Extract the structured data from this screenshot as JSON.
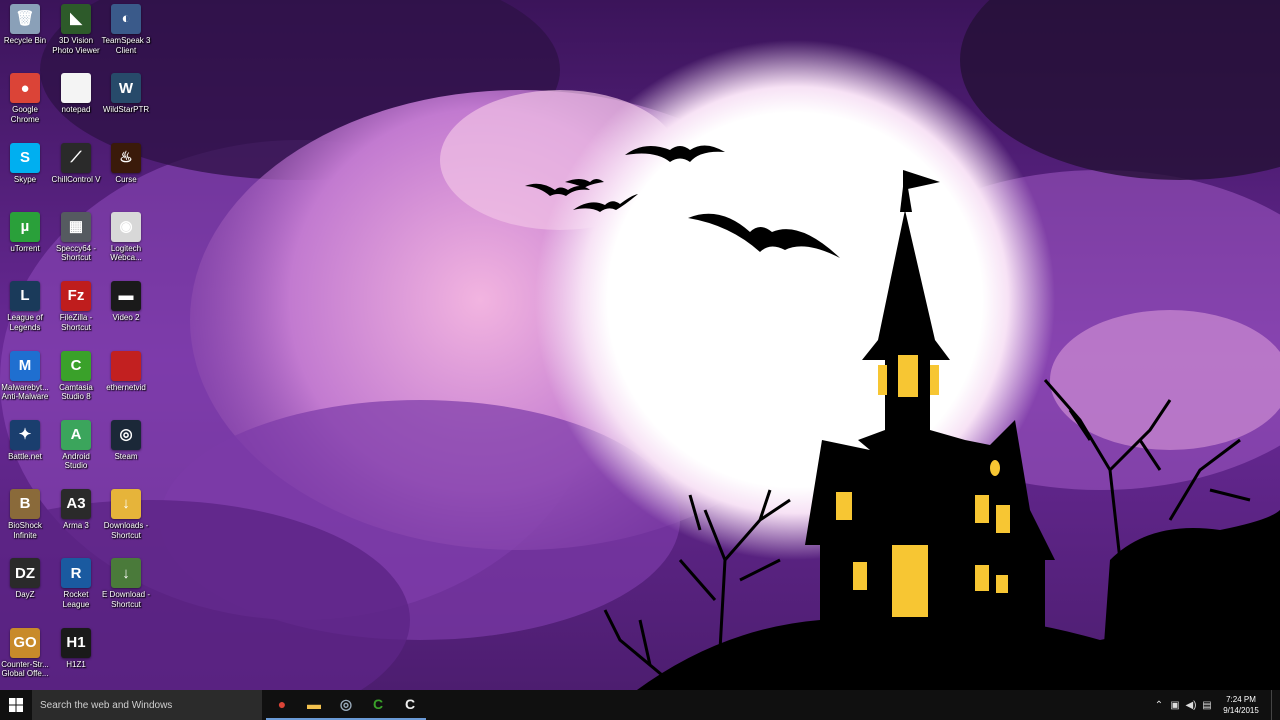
{
  "desktop": {
    "icons": [
      {
        "label": "Recycle Bin",
        "glyph": "🗑",
        "bg": "#8aa0b8"
      },
      {
        "label": "3D Vision Photo Viewer",
        "glyph": "◣",
        "bg": "#2d5a2a"
      },
      {
        "label": "TeamSpeak 3 Client",
        "glyph": "◐",
        "bg": "#3a5a8a"
      },
      {
        "label": "Google Chrome",
        "glyph": "●",
        "bg": "#db4437"
      },
      {
        "label": "notepad",
        "glyph": "",
        "bg": "#f4f4f4"
      },
      {
        "label": "WildStarPTR",
        "glyph": "W",
        "bg": "#274a6a"
      },
      {
        "label": "Skype",
        "glyph": "S",
        "bg": "#00aff0"
      },
      {
        "label": "ChillControl V",
        "glyph": "⟋",
        "bg": "#2a2a2a"
      },
      {
        "label": "Curse",
        "glyph": "♨",
        "bg": "#3a1a0a"
      },
      {
        "label": "uTorrent",
        "glyph": "µ",
        "bg": "#2aa03a"
      },
      {
        "label": "Speccy64 - Shortcut",
        "glyph": "▦",
        "bg": "#555a60"
      },
      {
        "label": "Logitech Webca...",
        "glyph": "◉",
        "bg": "#d8d8d8"
      },
      {
        "label": "League of Legends",
        "glyph": "L",
        "bg": "#1a3a5a"
      },
      {
        "label": "FileZilla - Shortcut",
        "glyph": "Fz",
        "bg": "#bf1d1d"
      },
      {
        "label": "Video 2",
        "glyph": "▬",
        "bg": "#1a1a1a"
      },
      {
        "label": "Malwarebyt... Anti-Malware",
        "glyph": "M",
        "bg": "#1f6fd0"
      },
      {
        "label": "Camtasia Studio 8",
        "glyph": "C",
        "bg": "#3aa12a"
      },
      {
        "label": "ethernetvid",
        "glyph": "",
        "bg": "#c22020"
      },
      {
        "label": "Battle.net",
        "glyph": "✦",
        "bg": "#1a3e6e"
      },
      {
        "label": "Android Studio",
        "glyph": "A",
        "bg": "#3ba55c"
      },
      {
        "label": "Steam",
        "glyph": "◎",
        "bg": "#1b2838"
      },
      {
        "label": "BioShock Infinite",
        "glyph": "B",
        "bg": "#8a6a3a"
      },
      {
        "label": "Arma 3",
        "glyph": "A3",
        "bg": "#2a2a2a"
      },
      {
        "label": "Downloads - Shortcut",
        "glyph": "↓",
        "bg": "#e6b43a"
      },
      {
        "label": "DayZ",
        "glyph": "DZ",
        "bg": "#2a2a2a"
      },
      {
        "label": "Rocket League",
        "glyph": "R",
        "bg": "#1a5aa0"
      },
      {
        "label": "E Download - Shortcut",
        "glyph": "↓",
        "bg": "#4a7a3a"
      },
      {
        "label": "Counter-Str... Global Offe...",
        "glyph": "GO",
        "bg": "#c88a2a"
      },
      {
        "label": "H1Z1",
        "glyph": "H1",
        "bg": "#1a1a1a"
      }
    ]
  },
  "taskbar": {
    "search_placeholder": "Search the web and Windows",
    "pinned": [
      {
        "name": "chrome",
        "glyph": "●",
        "color": "#db4437"
      },
      {
        "name": "file-explorer",
        "glyph": "▬",
        "color": "#f2c14e"
      },
      {
        "name": "steam",
        "glyph": "◎",
        "color": "#9ab"
      },
      {
        "name": "camtasia-studio",
        "glyph": "C",
        "color": "#3aa12a"
      },
      {
        "name": "camtasia-recorder",
        "glyph": "C",
        "color": "#eee"
      }
    ],
    "clock": {
      "time": "7:24 PM",
      "date": "9/14/2015"
    }
  },
  "colors": {
    "sky_purple": "#4b1f6e",
    "cloud_pink": "#e9a6d9",
    "moon": "#ffffff",
    "silhouette": "#000000",
    "window_light": "#f7c633"
  }
}
